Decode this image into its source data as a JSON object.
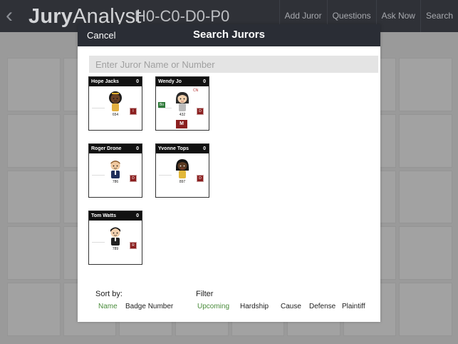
{
  "topbar": {
    "brand_bold": "Jury",
    "brand_light": "Analyst",
    "code": "H0-C0-D0-P0",
    "nav": [
      "Add Juror",
      "Questions",
      "Ask Now",
      "Search"
    ]
  },
  "modal": {
    "cancel_label": "Cancel",
    "title": "Search Jurors",
    "search_placeholder": "Enter Juror Name or Number"
  },
  "jurors": [
    {
      "name": "Hope Jacks",
      "count": "0",
      "number": "654",
      "tag": "I"
    },
    {
      "name": "Wendy Jo",
      "count": "0",
      "number": "432",
      "tag": "D",
      "cn": "CN",
      "side_badge": "Bo",
      "m_badge": "M"
    },
    {
      "name": "Roger Drone",
      "count": "0",
      "number": "786",
      "tag": "D"
    },
    {
      "name": "Yvonne Tops",
      "count": "0",
      "number": "897",
      "tag": "D"
    },
    {
      "name": "Tom Watts",
      "count": "0",
      "number": "789",
      "tag": "R"
    }
  ],
  "sort": {
    "label": "Sort by:",
    "options": [
      "Name",
      "Badge Number"
    ],
    "active": "Name"
  },
  "filter": {
    "label": "Filter",
    "options": [
      "Upcoming",
      "Hardship",
      "Cause",
      "Defense",
      "Plaintiff"
    ],
    "active": "Upcoming"
  },
  "colors": {
    "topbar": "#2f3137",
    "modal_header": "#2a2d35",
    "accent_active": "#4a8c3b",
    "tag_red": "#8b1f1f",
    "tag_green": "#2f7a3a"
  }
}
